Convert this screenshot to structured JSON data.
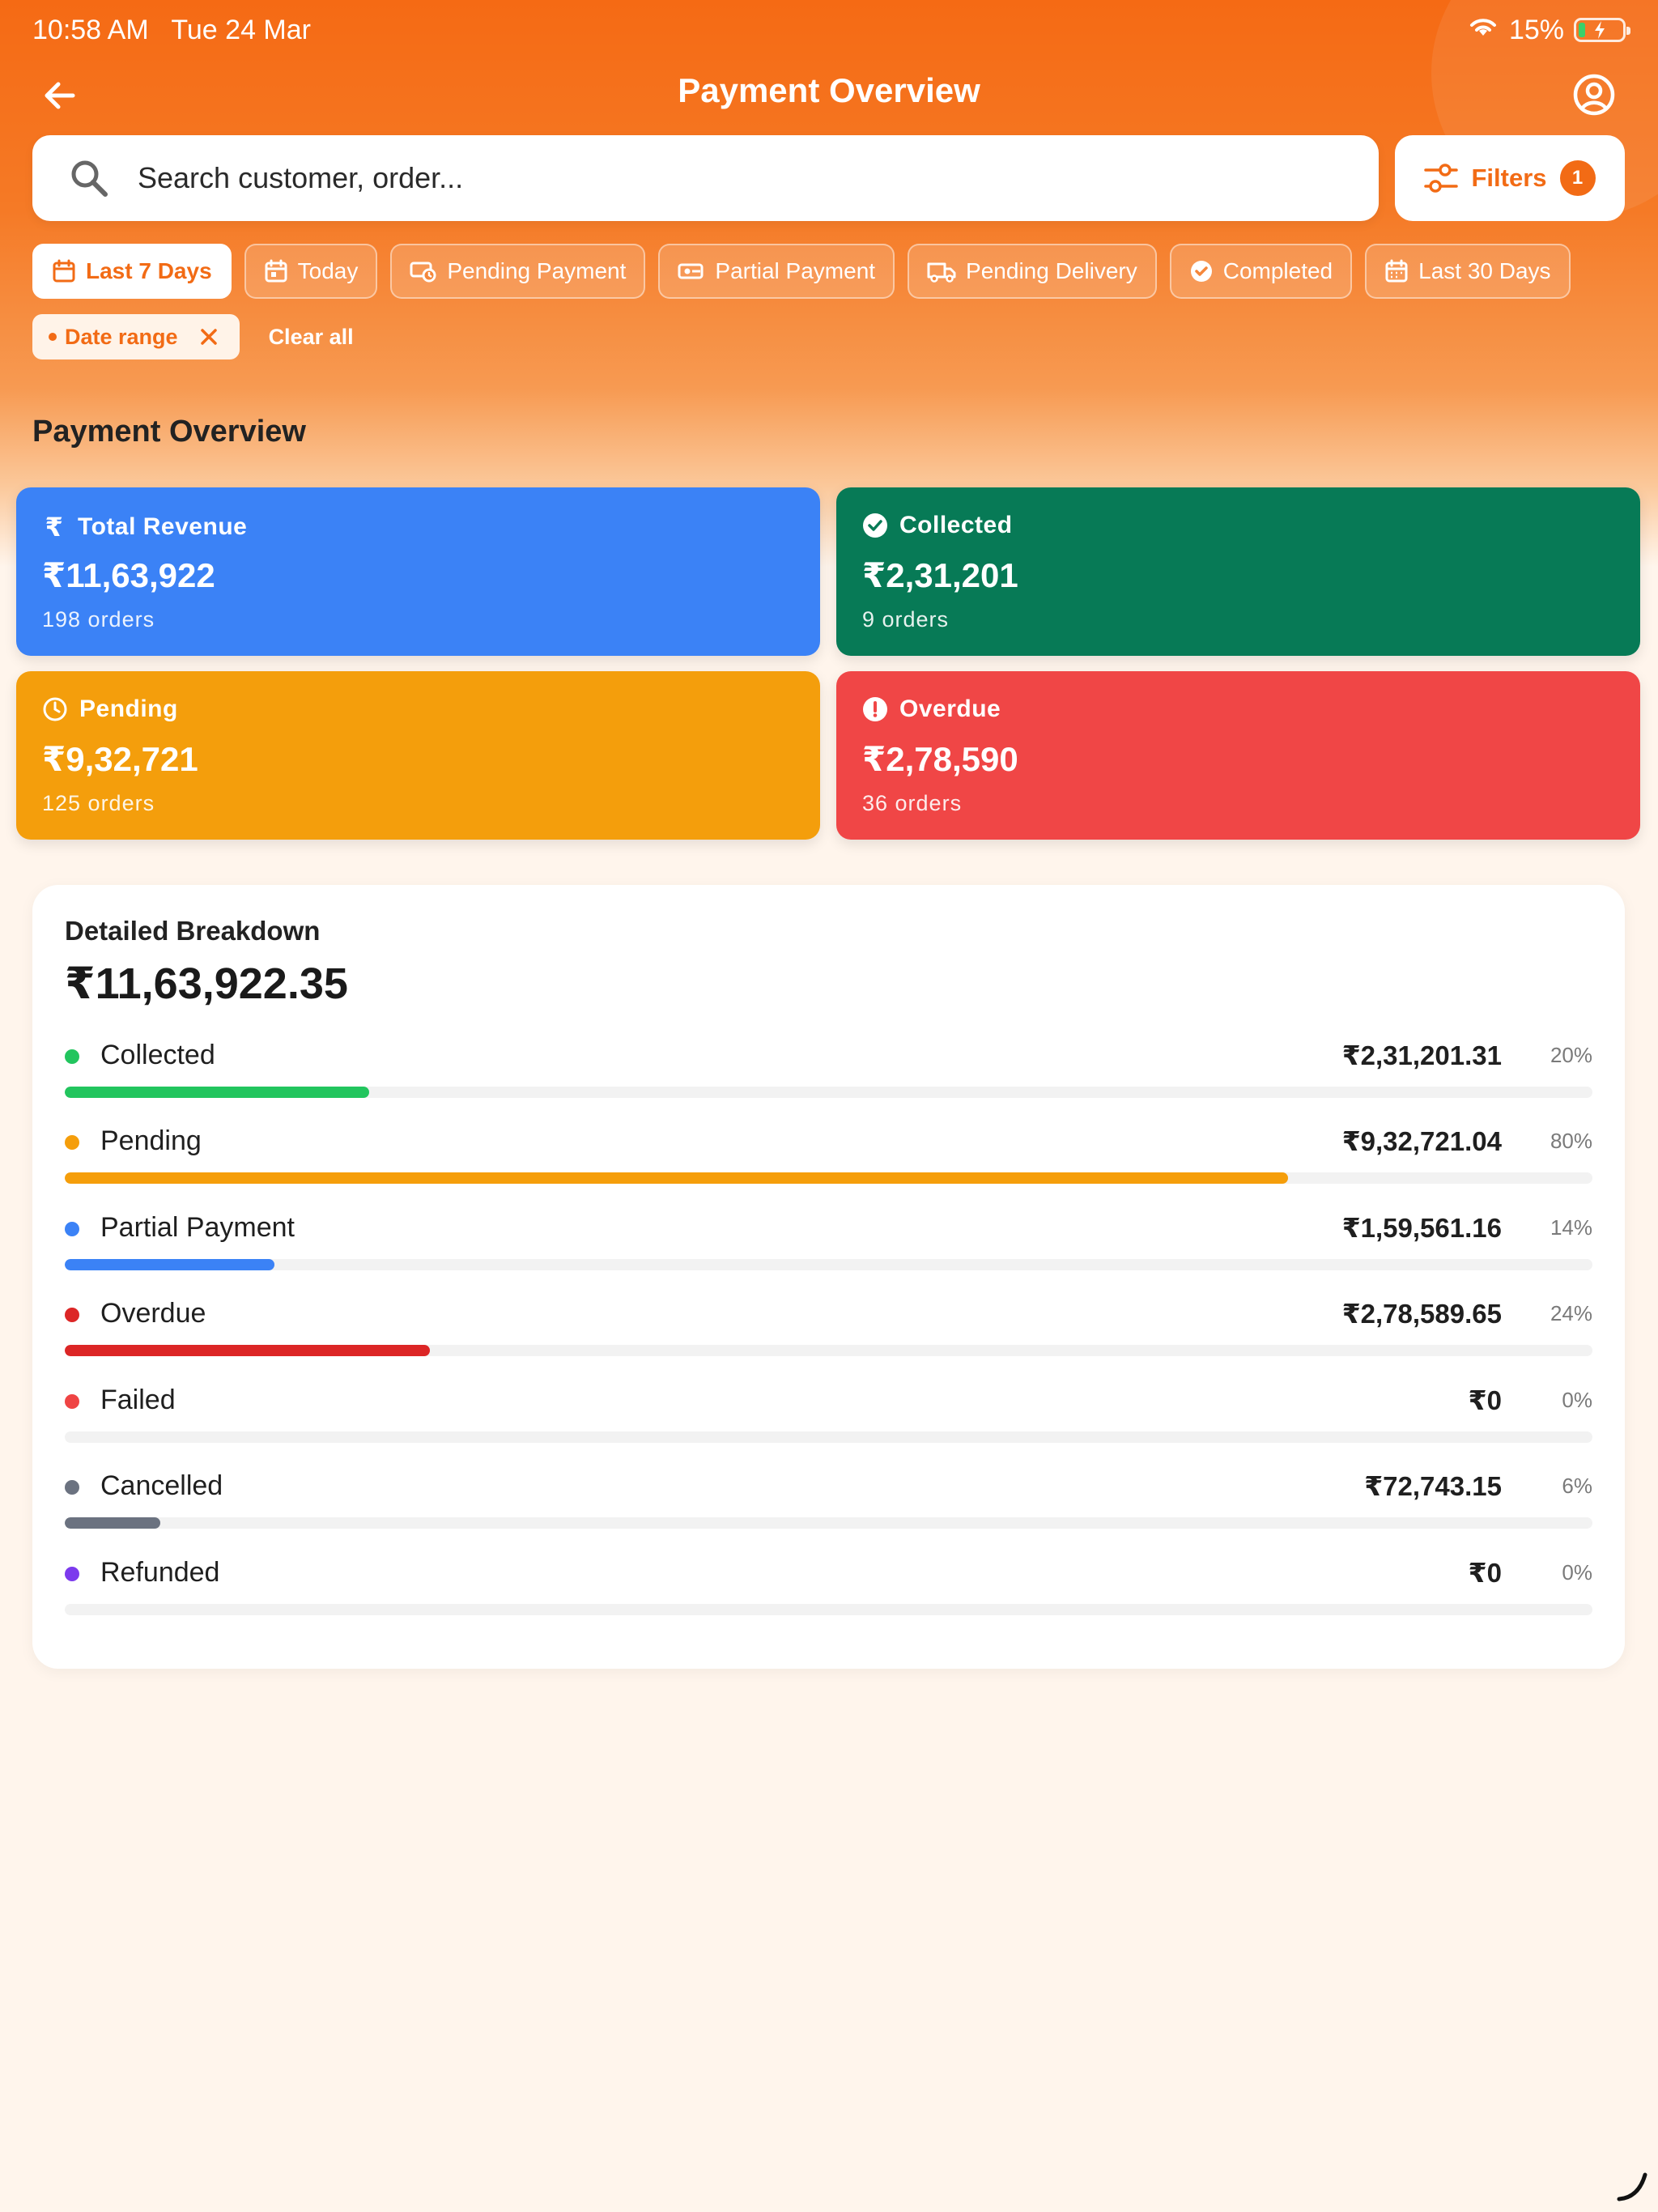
{
  "status_bar": {
    "time": "10:58 AM",
    "date": "Tue 24 Mar",
    "battery": "15%"
  },
  "header": {
    "title": "Payment Overview"
  },
  "search": {
    "placeholder": "Search customer, order..."
  },
  "filters": {
    "label": "Filters",
    "count": "1"
  },
  "chips": [
    {
      "label": "Last 7 Days",
      "icon": "calendar-icon",
      "active": true
    },
    {
      "label": "Today",
      "icon": "calendar-icon",
      "active": false
    },
    {
      "label": "Pending Payment",
      "icon": "pending-payment-icon",
      "active": false
    },
    {
      "label": "Partial Payment",
      "icon": "partial-payment-icon",
      "active": false
    },
    {
      "label": "Pending Delivery",
      "icon": "truck-icon",
      "active": false
    },
    {
      "label": "Completed",
      "icon": "check-circle-icon",
      "active": false
    },
    {
      "label": "Last 30 Days",
      "icon": "calendar-grid-icon",
      "active": false
    }
  ],
  "active_filters": {
    "date_range": "Date range",
    "clear_all": "Clear all"
  },
  "section_title": "Payment Overview",
  "cards": {
    "total_revenue": {
      "label": "Total Revenue",
      "value": "₹11,63,922",
      "orders": "198 orders",
      "color": "#3b82f6"
    },
    "collected": {
      "label": "Collected",
      "value": "₹2,31,201",
      "orders": "9 orders",
      "color": "#077a56"
    },
    "pending": {
      "label": "Pending",
      "value": "₹9,32,721",
      "orders": "125 orders",
      "color": "#f49e0c"
    },
    "overdue": {
      "label": "Overdue",
      "value": "₹2,78,590",
      "orders": "36 orders",
      "color": "#f04646"
    }
  },
  "breakdown": {
    "title": "Detailed Breakdown",
    "total": "₹11,63,922.35",
    "rows": [
      {
        "name": "Collected",
        "amount": "₹2,31,201.31",
        "percent": "20%",
        "fraction": 0.199,
        "color": "#22c55e"
      },
      {
        "name": "Pending",
        "amount": "₹9,32,721.04",
        "percent": "80%",
        "fraction": 0.801,
        "color": "#f59e0b"
      },
      {
        "name": "Partial Payment",
        "amount": "₹1,59,561.16",
        "percent": "14%",
        "fraction": 0.137,
        "color": "#3b82f6"
      },
      {
        "name": "Overdue",
        "amount": "₹2,78,589.65",
        "percent": "24%",
        "fraction": 0.239,
        "color": "#dc2626"
      },
      {
        "name": "Failed",
        "amount": "₹0",
        "percent": "0%",
        "fraction": 0,
        "color": "#ef4444"
      },
      {
        "name": "Cancelled",
        "amount": "₹72,743.15",
        "percent": "6%",
        "fraction": 0.0625,
        "color": "#6b7280"
      },
      {
        "name": "Refunded",
        "amount": "₹0",
        "percent": "0%",
        "fraction": 0,
        "color": "#7c3aed"
      }
    ]
  }
}
